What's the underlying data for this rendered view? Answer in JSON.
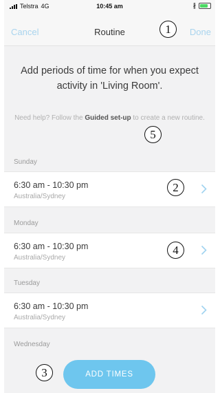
{
  "status_bar": {
    "carrier": "Telstra",
    "network": "4G",
    "time": "10:45 am"
  },
  "nav": {
    "cancel_label": "Cancel",
    "title": "Routine",
    "done_label": "Done"
  },
  "intro_text": "Add periods of time for when you expect activity in 'Living Room'.",
  "help": {
    "prefix": "Need help? Follow the ",
    "link_label": "Guided set-up",
    "suffix": " to create a new routine."
  },
  "days": [
    {
      "day": "Sunday",
      "time": "6:30 am - 10:30 pm",
      "timezone": "Australia/Sydney"
    },
    {
      "day": "Monday",
      "time": "6:30 am - 10:30 pm",
      "timezone": "Australia/Sydney"
    },
    {
      "day": "Tuesday",
      "time": "6:30 am - 10:30 pm",
      "timezone": "Australia/Sydney"
    }
  ],
  "next_day_label": "Wednesday",
  "add_times_label": "ADD TIMES",
  "annotations": [
    "1",
    "2",
    "3",
    "4",
    "5"
  ],
  "colors": {
    "accent": "#6ec6ee",
    "nav_link": "#a9d4ee",
    "background": "#f2f2f3",
    "chevron": "#9fd3f0",
    "battery": "#4cd964"
  }
}
